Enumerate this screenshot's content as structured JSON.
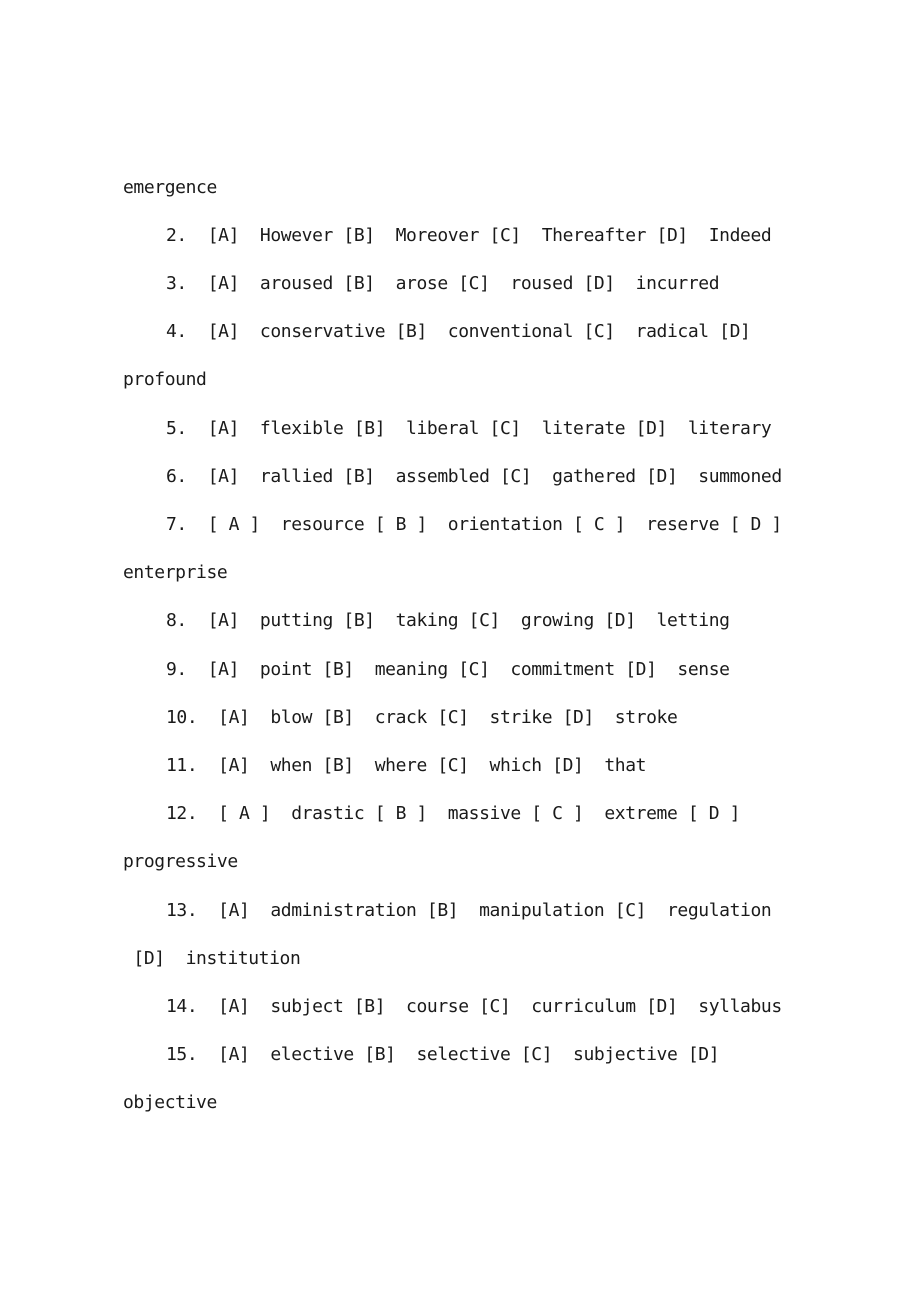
{
  "document": {
    "lines": [
      {
        "text": "emergence"
      },
      {
        "text": "2.  [A]  However [B]  Moreover [C]  Thereafter [D]  Indeed"
      },
      {
        "text": "3.  [A]  aroused [B]  arose [C]  roused [D]  incurred"
      },
      {
        "text": "4.  [A]  conservative [B]  conventional [C]  radical [D]"
      },
      {
        "text": "profound"
      },
      {
        "text": "5.  [A]  flexible [B]  liberal [C]  literate [D]  literary"
      },
      {
        "text": "6.  [A]  rallied [B]  assembled [C]  gathered [D]  summoned"
      },
      {
        "text": "7.  [ A ]  resource [ B ]  orientation [ C ]  reserve [ D ]"
      },
      {
        "text": "enterprise"
      },
      {
        "text": "8.  [A]  putting [B]  taking [C]  growing [D]  letting"
      },
      {
        "text": "9.  [A]  point [B]  meaning [C]  commitment [D]  sense"
      },
      {
        "text": "10.  [A]  blow [B]  crack [C]  strike [D]  stroke"
      },
      {
        "text": "11.  [A]  when [B]  where [C]  which [D]  that"
      },
      {
        "text": "12.  [ A ]  drastic [ B ]  massive [ C ]  extreme [ D ]"
      },
      {
        "text": "progressive"
      },
      {
        "text": "13.  [A]  administration [B]  manipulation [C]  regulation"
      },
      {
        "text": " [D]  institution"
      },
      {
        "text": "14.  [A]  subject [B]  course [C]  curriculum [D]  syllabus"
      },
      {
        "text": "15.  [A]  elective [B]  selective [C]  subjective [D]"
      },
      {
        "text": "objective"
      }
    ]
  }
}
